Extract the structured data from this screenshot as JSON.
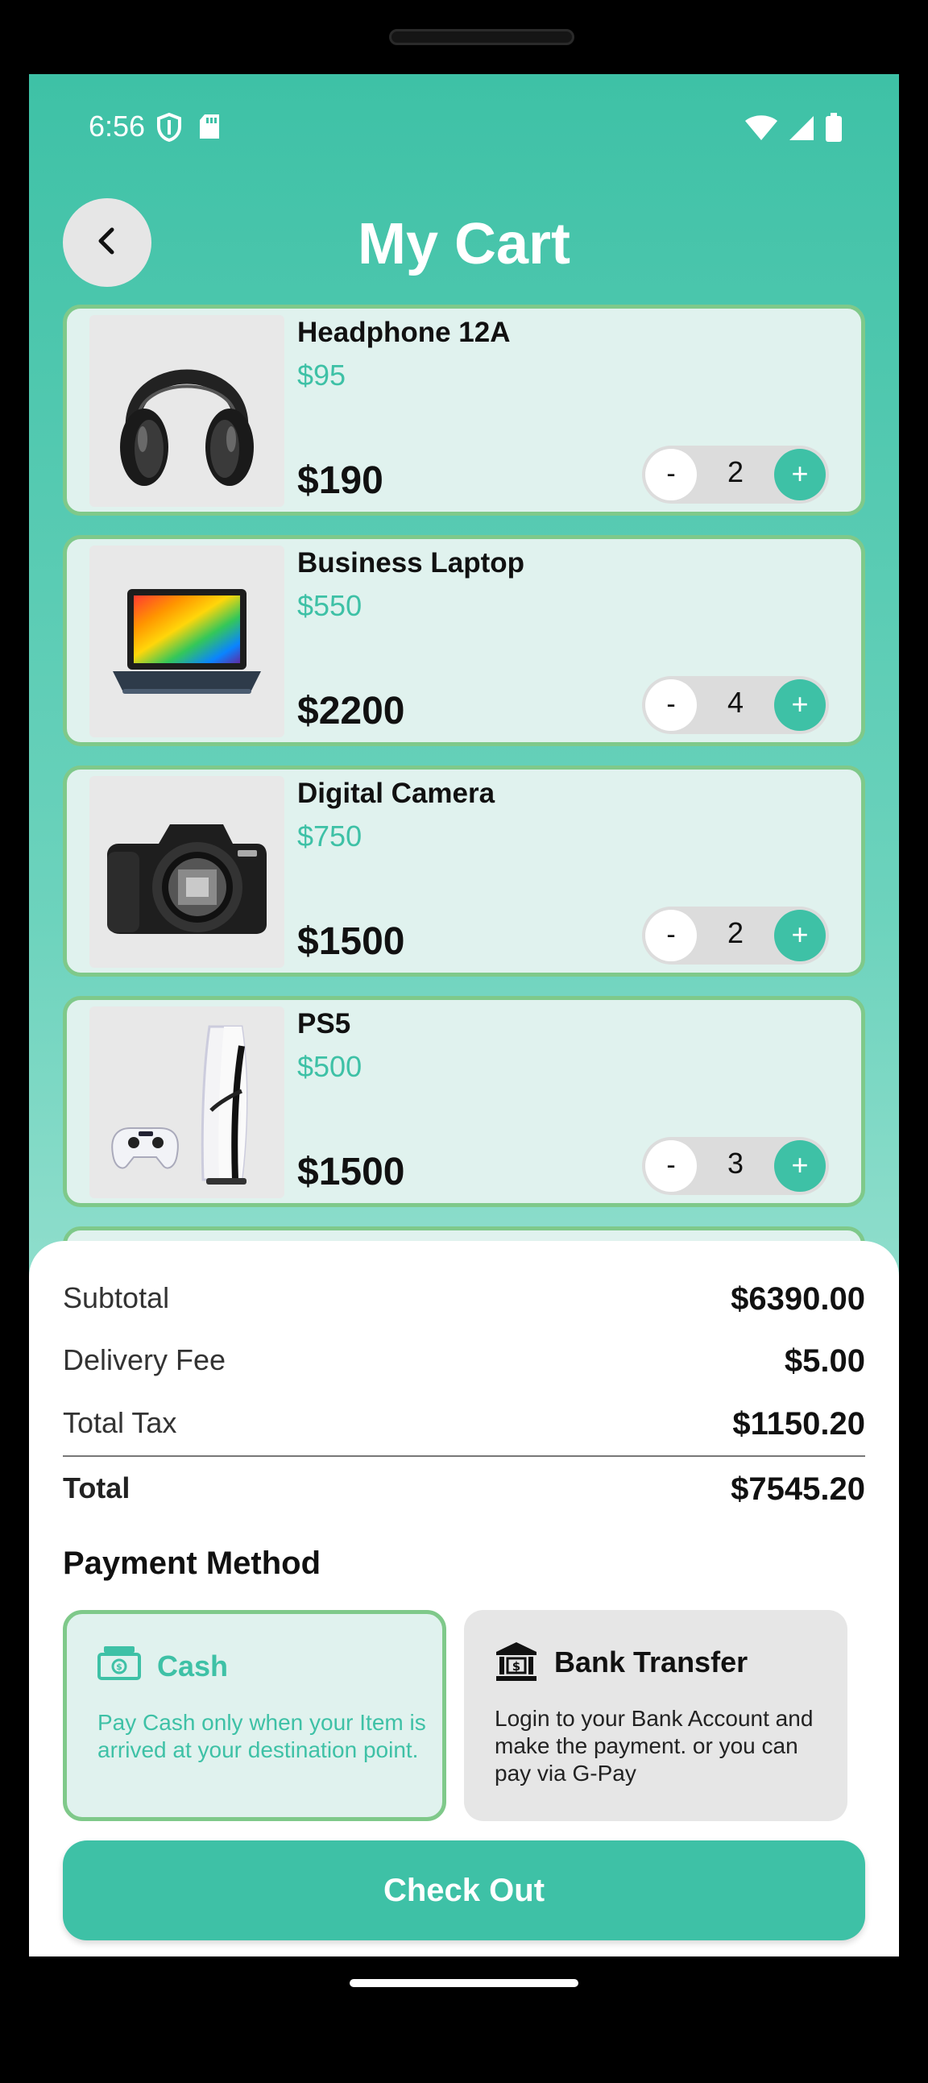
{
  "status_bar": {
    "time": "6:56",
    "icons": [
      "shield-icon",
      "sd-card-icon",
      "wifi-icon",
      "cellular-icon",
      "battery-icon"
    ]
  },
  "header": {
    "title": "My Cart",
    "back_icon": "chevron-left-icon"
  },
  "cart": {
    "items": [
      {
        "name": "Headphone 12A",
        "unit_price": "$95",
        "total": "$190",
        "qty": "2",
        "minus": "-",
        "plus": "+",
        "image": "headphones"
      },
      {
        "name": " Business Laptop",
        "unit_price": "$550",
        "total": "$2200",
        "qty": "4",
        "minus": "-",
        "plus": "+",
        "image": "laptop"
      },
      {
        "name": "Digital Camera",
        "unit_price": "$750",
        "total": "$1500",
        "qty": "2",
        "minus": "-",
        "plus": "+",
        "image": "camera"
      },
      {
        "name": "PS5",
        "unit_price": "$500",
        "total": "$1500",
        "qty": "3",
        "minus": "-",
        "plus": "+",
        "image": "console"
      }
    ]
  },
  "summary": {
    "subtotal_label": "Subtotal",
    "subtotal_value": "$6390.00",
    "delivery_label": "Delivery Fee",
    "delivery_value": "$5.00",
    "tax_label": "Total Tax",
    "tax_value": "$1150.20",
    "total_label": "Total",
    "total_value": "$7545.20"
  },
  "payment": {
    "heading": "Payment Method",
    "cash": {
      "title": "Cash",
      "description": "Pay Cash only when your Item is arrived at your destination point.",
      "icon": "cash-icon",
      "selected": true
    },
    "bank": {
      "title": "Bank Transfer",
      "description": "Login to your Bank Account and make the payment. or you can pay via G-Pay",
      "icon": "bank-icon",
      "selected": false
    }
  },
  "checkout": {
    "label": "Check Out"
  },
  "colors": {
    "accent": "#3ec1a6",
    "card_border": "#7fc98a",
    "card_bg": "#e0f2ee"
  }
}
